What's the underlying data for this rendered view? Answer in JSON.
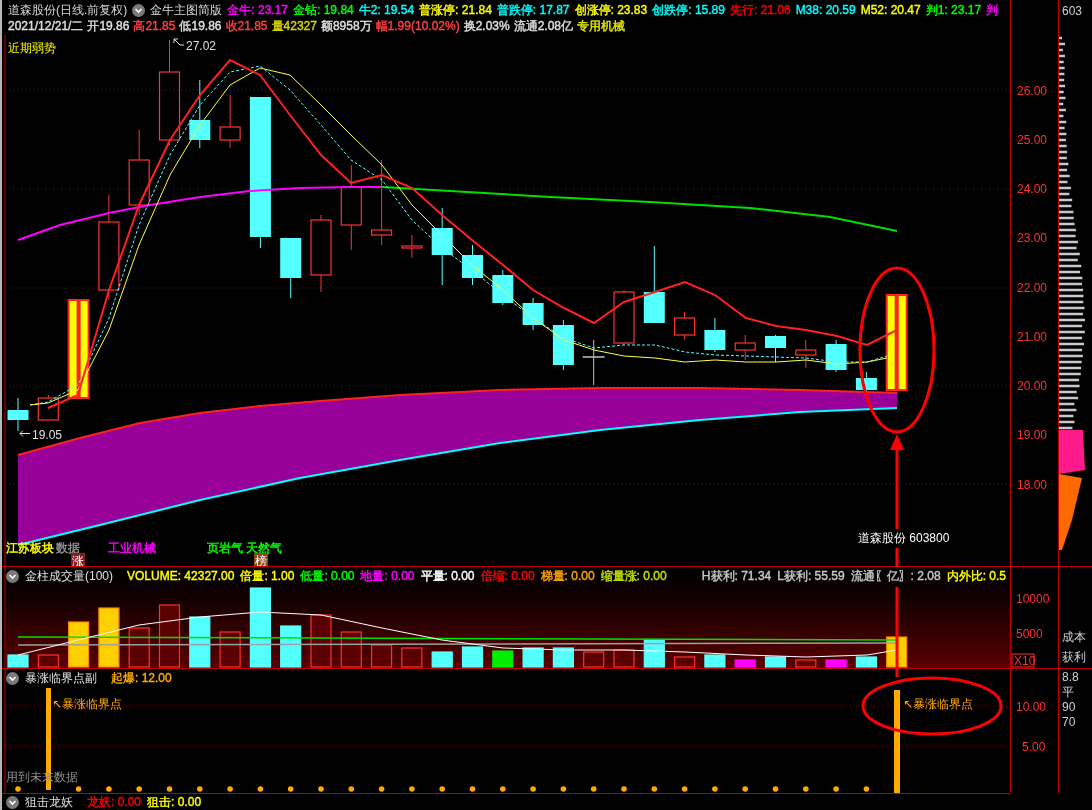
{
  "header": {
    "title": "道森股份(日线.前复权)",
    "indicator": "金牛主图简版",
    "values": [
      {
        "text": "金牛: 23.17",
        "color": "#ff00ff"
      },
      {
        "text": "金钻: 19.84",
        "color": "#00ff00"
      },
      {
        "text": "牛2: 19.54",
        "color": "#00ffff"
      },
      {
        "text": "普涨停: 21.84",
        "color": "#ffff00"
      },
      {
        "text": "普跌停: 17.87",
        "color": "#00ffff"
      },
      {
        "text": "创涨停: 23.83",
        "color": "#ffff00"
      },
      {
        "text": "创跌停: 15.89",
        "color": "#00ffff"
      },
      {
        "text": "先行: 21.06",
        "color": "#ff0000"
      },
      {
        "text": "M38: 20.59",
        "color": "#00ffff"
      },
      {
        "text": "M52: 20.47",
        "color": "#ffff00"
      },
      {
        "text": "判1: 23.17",
        "color": "#00ff00"
      },
      {
        "text": "判",
        "color": "#ff00ff"
      }
    ],
    "quote": [
      {
        "text": "2021/12/21/二",
        "color": "#e0e0e0"
      },
      {
        "text": "开19.86",
        "color": "#e0e0e0"
      },
      {
        "text": "高21.85",
        "color": "#ff4040"
      },
      {
        "text": "低19.86",
        "color": "#e0e0e0"
      },
      {
        "text": "收21.85",
        "color": "#ff4040"
      },
      {
        "text": "量42327",
        "color": "#d8d800"
      },
      {
        "text": "额8958万",
        "color": "#e0e0e0"
      },
      {
        "text": "幅1.99(10.02%)",
        "color": "#ff4040"
      },
      {
        "text": "换2.03%",
        "color": "#e0e0e0"
      },
      {
        "text": "流通2.08亿",
        "color": "#e0e0e0"
      },
      {
        "text": "专用机械",
        "color": "#e8e800"
      }
    ]
  },
  "main_chart": {
    "signal": "近期弱势",
    "high_mark": "27.02",
    "low_mark": "19.05",
    "yticks": [
      "26.00",
      "25.00",
      "24.00",
      "23.00",
      "22.00",
      "21.00",
      "20.00",
      "19.00",
      "18.00"
    ],
    "tags": [
      {
        "text": "江苏板块",
        "color": "#ffff00"
      },
      {
        "text": "数据",
        "color": "#909090"
      },
      {
        "text": "工业机械",
        "color": "#ff00ff"
      },
      {
        "text": "页岩气 天然气",
        "color": "#00ff00"
      }
    ],
    "badges": [
      {
        "text": "涨",
        "color": "#8b1a1a"
      },
      {
        "text": "榜",
        "color": "#8b4a1a"
      }
    ],
    "stock": "道森股份 603800"
  },
  "volume": {
    "title": "金柱成交量(100)",
    "values": [
      {
        "text": "VOLUME: 42327.00",
        "color": "#ffff00"
      },
      {
        "text": "倍量: 1.00",
        "color": "#ffff00"
      },
      {
        "text": "低量: 0.00",
        "color": "#00ff00"
      },
      {
        "text": "地量: 0.00",
        "color": "#ff00ff"
      },
      {
        "text": "平量: 0.00",
        "color": "#ffffff"
      },
      {
        "text": "倍缩: 0.00",
        "color": "#ff0000"
      },
      {
        "text": "梯量: 0.00",
        "color": "#ffa500"
      },
      {
        "text": "缩量涨: 0.00",
        "color": "#c0e000"
      }
    ],
    "stats": [
      {
        "text": "H获利: 71.34",
        "color": "#c8c8c8"
      },
      {
        "text": "L获利: 55.59",
        "color": "#c8c8c8"
      },
      {
        "text": "流通〖亿〗: 2.08",
        "color": "#c8c8c8"
      },
      {
        "text": "内外比: 0.5",
        "color": "#ffff00"
      }
    ],
    "yticks": [
      "10000",
      "5000"
    ],
    "scale": "X10"
  },
  "indicator": {
    "title": "暴涨临界点副",
    "values": [
      {
        "text": "起爆: 12.00",
        "color": "#ffaa00"
      }
    ],
    "markers": [
      "↖暴涨临界点",
      "↖暴涨临界点"
    ],
    "note": "用到未来数据",
    "yticks": [
      "10.00",
      "5.00"
    ]
  },
  "bottom_indicator": {
    "title": "狙击龙妖",
    "values": [
      {
        "text": "龙妖: 0.00",
        "color": "#ff0000"
      },
      {
        "text": "狙击: 0.00",
        "color": "#ffff00"
      }
    ]
  },
  "side": {
    "code": "603",
    "volume_labels": [
      "成本",
      "获利"
    ],
    "indicator_labels": [
      "8.8",
      "平",
      "90",
      "70"
    ]
  }
}
